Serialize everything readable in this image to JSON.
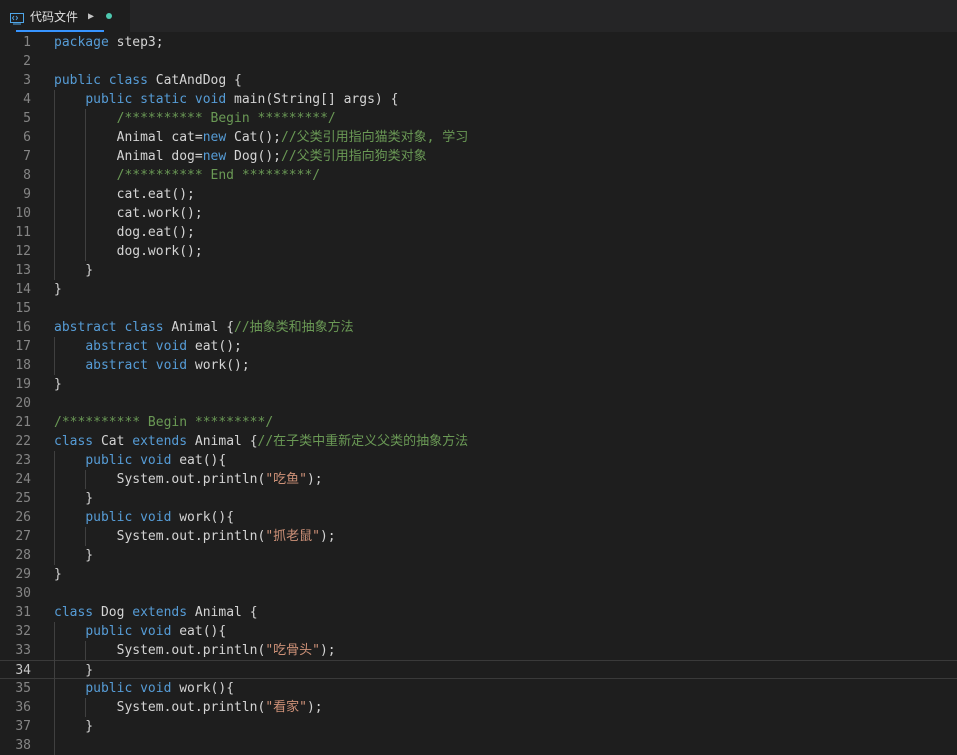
{
  "tab": {
    "label": "代码文件",
    "icon": "code-file-icon",
    "run_icon": "play-icon",
    "dirty_color": "#4ec9b0"
  },
  "editor": {
    "current_line": 34,
    "lines": [
      [
        {
          "t": "kw",
          "v": "package"
        },
        {
          "t": "p",
          "v": " step3;"
        }
      ],
      [],
      [
        {
          "t": "kw",
          "v": "public class"
        },
        {
          "t": "p",
          "v": " CatAndDog {"
        }
      ],
      [
        {
          "t": "p",
          "v": "    "
        },
        {
          "t": "kw",
          "v": "public static void"
        },
        {
          "t": "p",
          "v": " main(String[] args) {"
        }
      ],
      [
        {
          "t": "cm",
          "v": "        /********** Begin *********/"
        }
      ],
      [
        {
          "t": "p",
          "v": "        Animal cat="
        },
        {
          "t": "kw",
          "v": "new"
        },
        {
          "t": "p",
          "v": " Cat();"
        },
        {
          "t": "cm",
          "v": "//父类引用指向猫类对象, 学习"
        }
      ],
      [
        {
          "t": "p",
          "v": "        Animal dog="
        },
        {
          "t": "kw",
          "v": "new"
        },
        {
          "t": "p",
          "v": " Dog();"
        },
        {
          "t": "cm",
          "v": "//父类引用指向狗类对象"
        }
      ],
      [
        {
          "t": "cm",
          "v": "        /********** End *********/"
        }
      ],
      [
        {
          "t": "p",
          "v": "        cat.eat();"
        }
      ],
      [
        {
          "t": "p",
          "v": "        cat.work();"
        }
      ],
      [
        {
          "t": "p",
          "v": "        dog.eat();"
        }
      ],
      [
        {
          "t": "p",
          "v": "        dog.work();"
        }
      ],
      [
        {
          "t": "p",
          "v": "    }"
        }
      ],
      [
        {
          "t": "p",
          "v": "}"
        }
      ],
      [],
      [
        {
          "t": "kw",
          "v": "abstract class"
        },
        {
          "t": "p",
          "v": " Animal {"
        },
        {
          "t": "cm",
          "v": "//抽象类和抽象方法"
        }
      ],
      [
        {
          "t": "p",
          "v": "    "
        },
        {
          "t": "kw",
          "v": "abstract void"
        },
        {
          "t": "p",
          "v": " eat();"
        }
      ],
      [
        {
          "t": "p",
          "v": "    "
        },
        {
          "t": "kw",
          "v": "abstract void"
        },
        {
          "t": "p",
          "v": " work();"
        }
      ],
      [
        {
          "t": "p",
          "v": "}"
        }
      ],
      [],
      [
        {
          "t": "cm",
          "v": "/********** Begin *********/"
        }
      ],
      [
        {
          "t": "kw",
          "v": "class"
        },
        {
          "t": "p",
          "v": " Cat "
        },
        {
          "t": "kw",
          "v": "extends"
        },
        {
          "t": "p",
          "v": " Animal {"
        },
        {
          "t": "cm",
          "v": "//在子类中重新定义父类的抽象方法"
        }
      ],
      [
        {
          "t": "p",
          "v": "    "
        },
        {
          "t": "kw",
          "v": "public void"
        },
        {
          "t": "p",
          "v": " eat(){"
        }
      ],
      [
        {
          "t": "p",
          "v": "        System.out.println("
        },
        {
          "t": "str",
          "v": "\"吃鱼\""
        },
        {
          "t": "p",
          "v": ");"
        }
      ],
      [
        {
          "t": "p",
          "v": "    }"
        }
      ],
      [
        {
          "t": "p",
          "v": "    "
        },
        {
          "t": "kw",
          "v": "public void"
        },
        {
          "t": "p",
          "v": " work(){"
        }
      ],
      [
        {
          "t": "p",
          "v": "        System.out.println("
        },
        {
          "t": "str",
          "v": "\"抓老鼠\""
        },
        {
          "t": "p",
          "v": ");"
        }
      ],
      [
        {
          "t": "p",
          "v": "    }"
        }
      ],
      [
        {
          "t": "p",
          "v": "}"
        }
      ],
      [],
      [
        {
          "t": "kw",
          "v": "class"
        },
        {
          "t": "p",
          "v": " Dog "
        },
        {
          "t": "kw",
          "v": "extends"
        },
        {
          "t": "p",
          "v": " Animal {"
        }
      ],
      [
        {
          "t": "p",
          "v": "    "
        },
        {
          "t": "kw",
          "v": "public void"
        },
        {
          "t": "p",
          "v": " eat(){"
        }
      ],
      [
        {
          "t": "p",
          "v": "        System.out.println("
        },
        {
          "t": "str",
          "v": "\"吃骨头\""
        },
        {
          "t": "p",
          "v": ");"
        }
      ],
      [
        {
          "t": "p",
          "v": "    }"
        }
      ],
      [
        {
          "t": "p",
          "v": "    "
        },
        {
          "t": "kw",
          "v": "public void"
        },
        {
          "t": "p",
          "v": " work(){"
        }
      ],
      [
        {
          "t": "p",
          "v": "        System.out.println("
        },
        {
          "t": "str",
          "v": "\"看家\""
        },
        {
          "t": "p",
          "v": ");"
        }
      ],
      [
        {
          "t": "p",
          "v": "    }"
        }
      ],
      []
    ]
  }
}
